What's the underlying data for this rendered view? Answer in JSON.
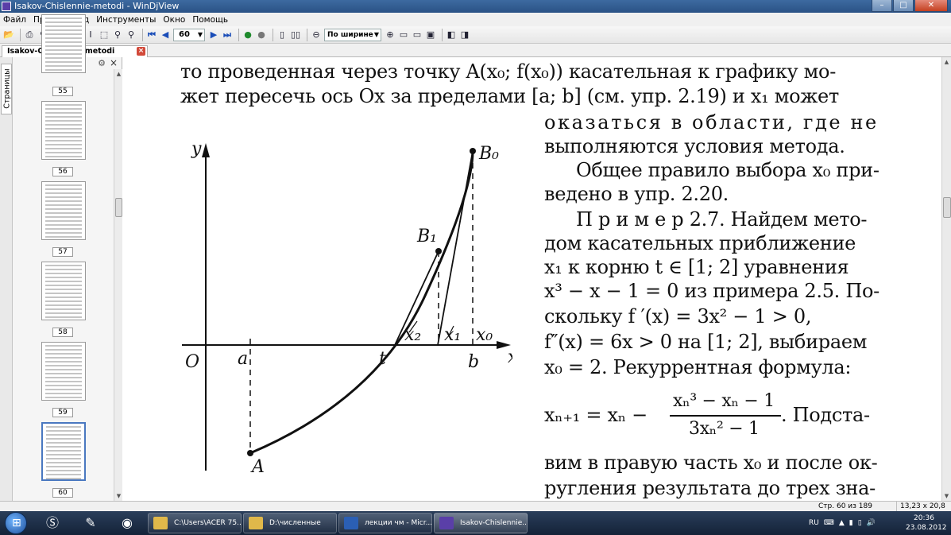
{
  "window": {
    "title": "Isakov-Chislennie-metodi - WinDjView",
    "min": "–",
    "max": "□",
    "close": "✕"
  },
  "menu": [
    "Файл",
    "Правка",
    "Вид",
    "Инструменты",
    "Окно",
    "Помощь"
  ],
  "toolbar": {
    "page_number": "60",
    "zoom": "По ширине"
  },
  "tab": {
    "label": "Isakov-Chislennie-metodi",
    "close": "×"
  },
  "sidebar": {
    "tab_label": "Страницы",
    "thumbnails": [
      {
        "page": "55"
      },
      {
        "page": "56"
      },
      {
        "page": "57"
      },
      {
        "page": "58"
      },
      {
        "page": "59"
      },
      {
        "page": "60"
      }
    ]
  },
  "document": {
    "lines": [
      "то проведенная через точку A(x₀; f(x₀)) касательная к графику мо-",
      "жет пересечь ось Ox за пределами [a; b] (см. упр. 2.19) и x₁ может",
      "оказаться в области, где не",
      "выполняются условия метода.",
      "Общее правило выбора x₀ при-",
      "ведено в упр. 2.20.",
      "П р и м е р  2.7. Найдем мето-",
      "дом касательных приближение",
      "x₁ к корню t ∈ [1; 2] уравнения",
      "x³ − x − 1 = 0 из примера 2.5. По-",
      "скольку f ′(x) = 3x² − 1 > 0,",
      "f″(x) = 6x > 0 на [1; 2], выбираем",
      "x₀ = 2. Рекуррентная формула:",
      "вим в правую часть x₀ и после ок-",
      "ругления результата до трех зна-"
    ],
    "formula": {
      "lhs": "xₙ₊₁ = xₙ −",
      "numerator": "xₙ³ − xₙ − 1",
      "denominator": "3xₙ² − 1",
      "tail": ". Подста-"
    },
    "figure_labels": {
      "y": "y",
      "x": "x",
      "O": "O",
      "a": "a",
      "t": "t",
      "b": "b",
      "x2": "x₂",
      "x1": "x₁",
      "x0": "x₀",
      "A": "A",
      "B1": "B₁",
      "B0": "B₀"
    }
  },
  "status": {
    "page": "Стр. 60 из 189",
    "size": "13,23 x 20,8 см"
  },
  "taskbar": {
    "tasks": [
      {
        "label": "C:\\Users\\ACER 75...",
        "color": "#e0b84a"
      },
      {
        "label": "D:\\численные",
        "color": "#e0b84a"
      },
      {
        "label": "лекции чм - Micr...",
        "color": "#2b5fb4"
      },
      {
        "label": "Isakov-Chislennie...",
        "color": "#5a3fa8"
      }
    ],
    "lang": "RU",
    "time": "20:36",
    "date": "23.08.2012"
  }
}
